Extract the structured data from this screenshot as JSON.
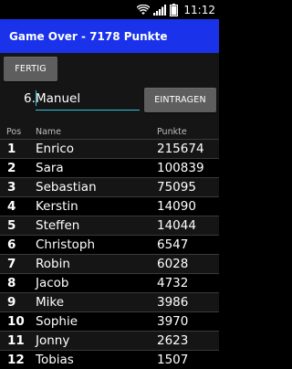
{
  "status_bar": {
    "time": "11:12",
    "icons": [
      "wifi-icon",
      "signal-icon",
      "battery-icon"
    ]
  },
  "app_bar": {
    "title": "Game Over - 7178 Punkte",
    "background_color": "#1a33ea"
  },
  "actions": {
    "fertig_label": "FERTIG",
    "eintragen_label": "EINTRAGEN"
  },
  "entry": {
    "rank_label": "6.",
    "name_value": "Manuel"
  },
  "table": {
    "columns": {
      "pos": "Pos",
      "name": "Name",
      "score": "Punkte"
    },
    "rows": [
      {
        "pos": "1",
        "name": "Enrico",
        "score": "215674"
      },
      {
        "pos": "2",
        "name": "Sara",
        "score": "100839"
      },
      {
        "pos": "3",
        "name": "Sebastian",
        "score": "75095"
      },
      {
        "pos": "4",
        "name": "Kerstin",
        "score": "14090"
      },
      {
        "pos": "5",
        "name": "Steffen",
        "score": "14044"
      },
      {
        "pos": "6",
        "name": "Christoph",
        "score": "6547"
      },
      {
        "pos": "7",
        "name": "Robin",
        "score": "6028"
      },
      {
        "pos": "8",
        "name": "Jacob",
        "score": "4732"
      },
      {
        "pos": "9",
        "name": "Mike",
        "score": "3986"
      },
      {
        "pos": "10",
        "name": "Sophie",
        "score": "3970"
      },
      {
        "pos": "11",
        "name": "Jonny",
        "score": "2623"
      },
      {
        "pos": "12",
        "name": "Tobias",
        "score": "1507"
      }
    ]
  },
  "accent_color": "#2ec4d6"
}
